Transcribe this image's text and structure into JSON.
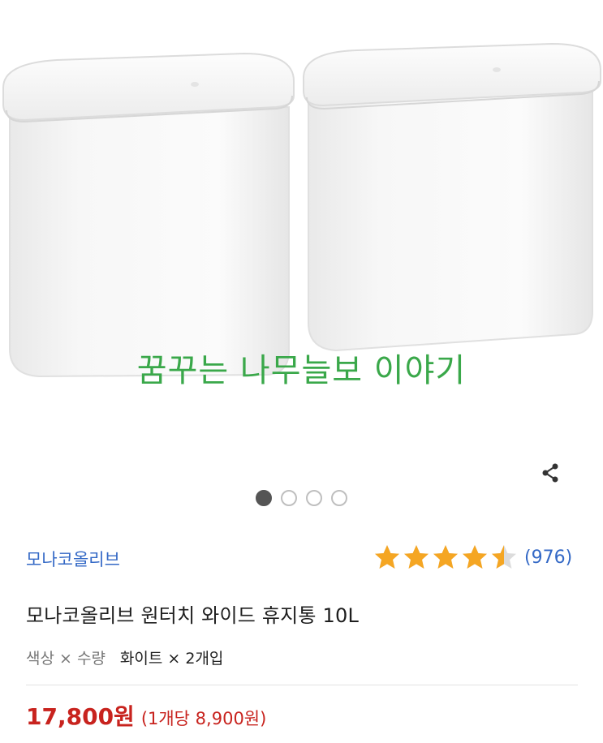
{
  "watermark": "꿈꾸는 나무늘보 이야기",
  "carousel": {
    "total": 4,
    "active": 0
  },
  "brand": "모나코올리브",
  "rating": {
    "value": 4.5,
    "max": 5,
    "count_text": "(976)"
  },
  "title": "모나코올리브 원터치 와이드 휴지통 10L",
  "option": {
    "label": "색상 × 수량",
    "value": "화이트 × 2개입"
  },
  "price": {
    "main": "17,800원",
    "unit": "(1개당 8,900원)"
  },
  "colors": {
    "accent_blue": "#3469c6",
    "price_red": "#c8231e",
    "star": "#f5a623",
    "watermark": "#3aa84a"
  },
  "icons": {
    "share": "share-icon",
    "star": "star-icon"
  }
}
